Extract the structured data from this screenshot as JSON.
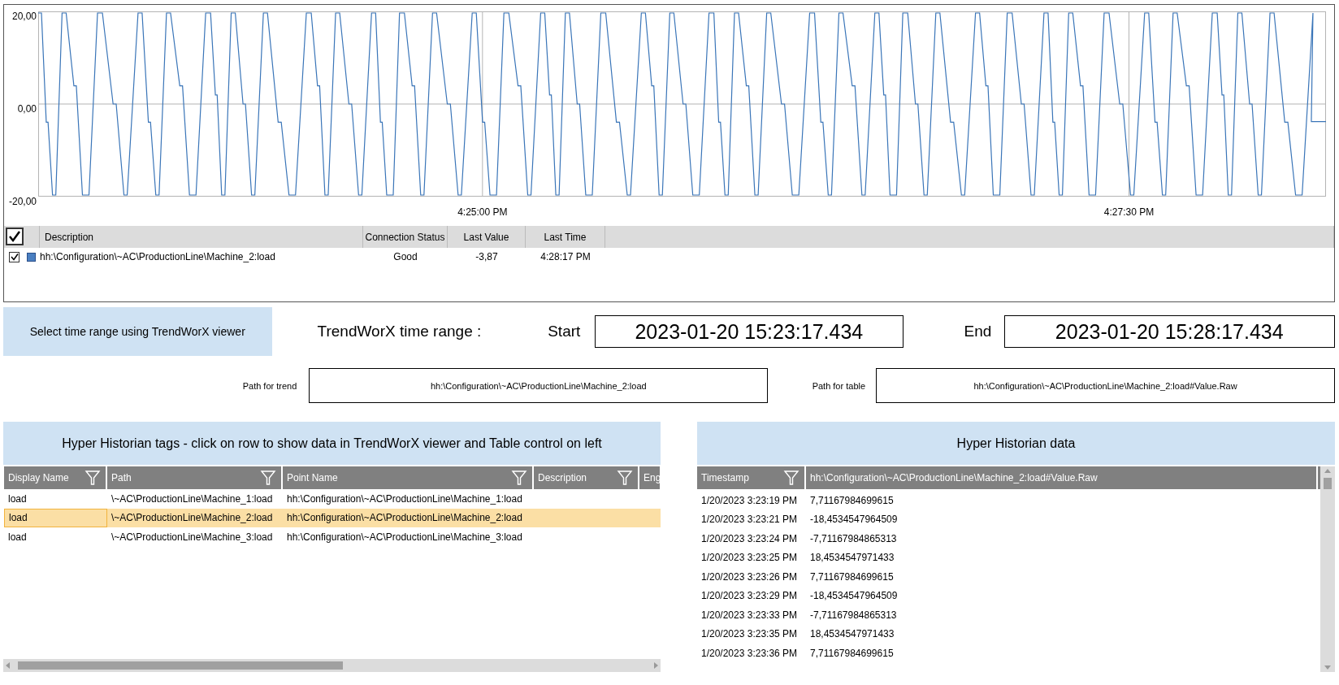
{
  "trend": {
    "y_labels": [
      "20,00",
      "0,00",
      "-20,00"
    ],
    "x_labels": [
      "4:25:00 PM",
      "4:27:30 PM"
    ],
    "legend": {
      "select_all_checked": true,
      "columns": [
        "Description",
        "Connection Status",
        "Last Value",
        "Last Time"
      ],
      "rows": [
        {
          "checked": true,
          "color": "#4a7fc1",
          "description": "hh:\\Configuration\\~AC\\ProductionLine\\Machine_2:load",
          "connection_status": "Good",
          "last_value": "-3,87",
          "last_time": "4:28:17 PM"
        }
      ]
    }
  },
  "range": {
    "select_button": "Select time range using TrendWorX viewer",
    "title": "TrendWorX time range :",
    "start_label": "Start",
    "start": "2023-01-20 15:23:17.434",
    "end_label": "End",
    "end": "2023-01-20 15:28:17.434",
    "trend_path_label": "Path for trend",
    "trend_path": "hh:\\Configuration\\~AC\\ProductionLine\\Machine_2:load",
    "table_path_label": "Path for table",
    "table_path": "hh:\\Configuration\\~AC\\ProductionLine\\Machine_2:load#Value.Raw"
  },
  "tags": {
    "title": "Hyper Historian tags - click on row to show data in TrendWorX viewer and Table control on left",
    "columns": [
      {
        "label": "Display Name",
        "filter": true
      },
      {
        "label": "Path",
        "filter": true
      },
      {
        "label": "Point Name",
        "filter": true
      },
      {
        "label": "Description",
        "filter": true
      },
      {
        "label": "Eng",
        "filter": false
      }
    ],
    "rows": [
      {
        "display_name": "load",
        "path": "\\~AC\\ProductionLine\\Machine_1:load",
        "point_name": "hh:\\Configuration\\~AC\\ProductionLine\\Machine_1:load",
        "selected": false
      },
      {
        "display_name": "load",
        "path": "\\~AC\\ProductionLine\\Machine_2:load",
        "point_name": "hh:\\Configuration\\~AC\\ProductionLine\\Machine_2:load",
        "selected": true
      },
      {
        "display_name": "load",
        "path": "\\~AC\\ProductionLine\\Machine_3:load",
        "point_name": "hh:\\Configuration\\~AC\\ProductionLine\\Machine_3:load",
        "selected": false
      }
    ]
  },
  "data": {
    "title": "Hyper Historian data",
    "columns": [
      {
        "label": "Timestamp",
        "filter": true
      },
      {
        "label": "hh:\\Configuration\\~AC\\ProductionLine\\Machine_2:load#Value.Raw",
        "filter": false
      }
    ],
    "rows": [
      {
        "timestamp": "1/20/2023 3:23:19 PM",
        "value": "7,71167984699615"
      },
      {
        "timestamp": "1/20/2023 3:23:21 PM",
        "value": "-18,4534547964509"
      },
      {
        "timestamp": "1/20/2023 3:23:24 PM",
        "value": "-7,71167984865313"
      },
      {
        "timestamp": "1/20/2023 3:23:25 PM",
        "value": "18,4534547971433"
      },
      {
        "timestamp": "1/20/2023 3:23:26 PM",
        "value": "7,71167984699615"
      },
      {
        "timestamp": "1/20/2023 3:23:29 PM",
        "value": "-18,4534547964509"
      },
      {
        "timestamp": "1/20/2023 3:23:33 PM",
        "value": "-7,71167984865313"
      },
      {
        "timestamp": "1/20/2023 3:23:35 PM",
        "value": "18,4534547971433"
      },
      {
        "timestamp": "1/20/2023 3:23:36 PM",
        "value": "7,71167984699615"
      }
    ]
  }
}
